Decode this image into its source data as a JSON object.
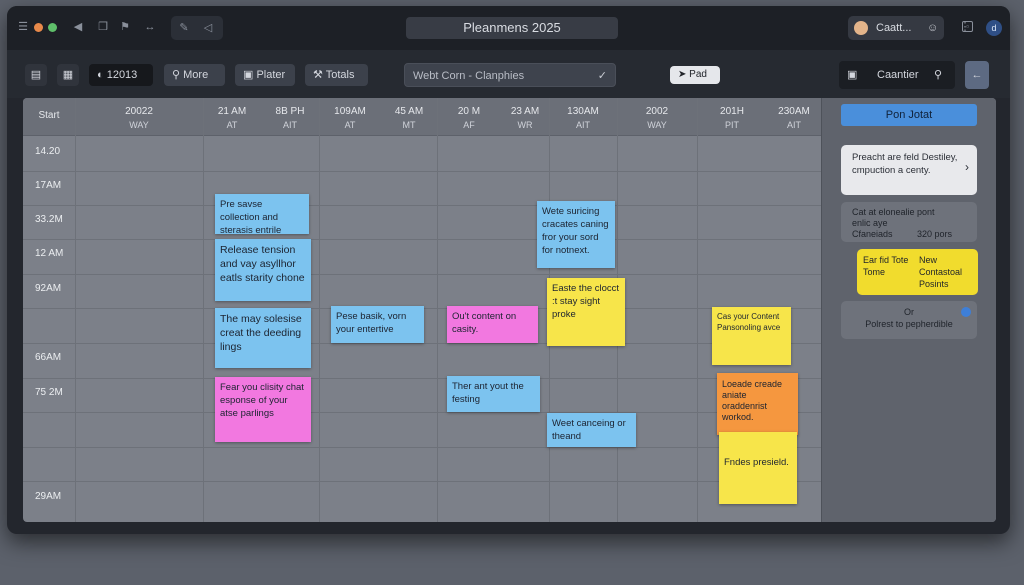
{
  "titlebar": {
    "app_title": "Pleanmens 2025",
    "user_name": "Caantier",
    "user_name_short": "Caatt..."
  },
  "toolbar": {
    "date_label": "12013",
    "more_label": "More",
    "filter_label": "Plater",
    "totals_label": "Totals",
    "search_value": "Webt Corn - Clanphies",
    "pad_label": "Pad",
    "account_label": "Caantier"
  },
  "grid": {
    "corner_label": "Start",
    "columns": [
      {
        "top": "20022",
        "bottom": "WAY"
      },
      {
        "top": "21 AM",
        "bottom": "AT"
      },
      {
        "top": "8B PH",
        "bottom": "AIT"
      },
      {
        "top": "109AM",
        "bottom": "AT"
      },
      {
        "top": "45 AM",
        "bottom": "MT"
      },
      {
        "top": "20 M",
        "bottom": "AF"
      },
      {
        "top": "23 AM",
        "bottom": "WR"
      },
      {
        "top": "130AM",
        "bottom": "AIT"
      },
      {
        "top": "2002",
        "bottom": "WAY"
      },
      {
        "top": "201H",
        "bottom": "PIT"
      },
      {
        "top": "230AM",
        "bottom": "AIT"
      }
    ],
    "times": [
      "14.20",
      "17AM",
      "33.2M",
      "12 AM",
      "92AM",
      "66AM",
      "75 2M",
      "29AM"
    ]
  },
  "notes": {
    "n1": "Pre savse collection and sterasis entrile",
    "n2": "Release tension and vay asyllhor eatls starity chone",
    "n3": "The may solesise creat the deeding lings",
    "n4": "Fear you clisity chat esponse of your atse parlings",
    "n5": "Pese basik, vorn your entertive",
    "n6": "Ou't content on casity.",
    "n7": "Ther ant yout the festing",
    "n8": "Wete suricing cracates caning fror your sord for notnext.",
    "n9": "Easte the clocct :t stay sight proke",
    "n10": "Weet canceing or theand",
    "n11": "Cas your Content Pansonoling avce",
    "n12": "Loeade creade aniate oraddenrist workod.",
    "n13": "Fndes presield."
  },
  "sidebar": {
    "button_label": "Pon Jotat",
    "card1_text": "Preacht are feld Destiley, cmpuction a centy.",
    "card2_line1": "Cat at elonealie pont",
    "card2_line2": "enlic aye",
    "card2_line3": "Cfaneiads",
    "card2_value": "320 pors",
    "card3_left": "Ear fid Tote Tome",
    "card3_right": "New Contastoal Posints",
    "card4_line1": "Or",
    "card4_line2": "Polrest to pepherdible"
  },
  "colors": {
    "note_blue": "#7cc3ef",
    "note_pink": "#f278e0",
    "note_yellow": "#f7e54a",
    "note_orange": "#f5973f",
    "accent": "#4a8fdb"
  }
}
